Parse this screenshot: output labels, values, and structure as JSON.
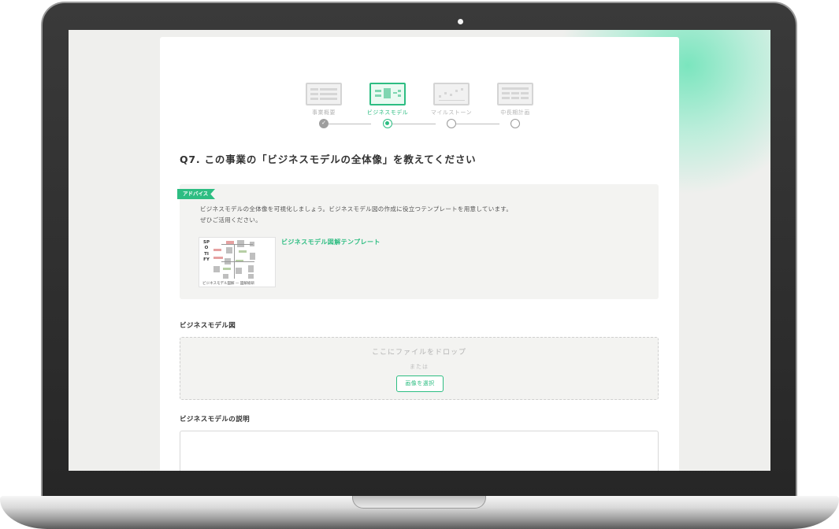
{
  "steps": [
    {
      "label": "事業概要",
      "state": "done",
      "check": "✓"
    },
    {
      "label": "ビジネスモデル",
      "state": "active"
    },
    {
      "label": "マイルストーン",
      "state": "todo"
    },
    {
      "label": "中長期計画",
      "state": "todo"
    }
  ],
  "question": {
    "title": "Q7. この事業の「ビジネスモデルの全体像」を教えてください"
  },
  "advice": {
    "badge": "アドバイス",
    "text": "ビジネスモデルの全体像を可視化しましょう。ビジネスモデル図の作成に役立つテンプレートを用意しています。\nぜひご活用ください。",
    "template_caption": "ビジネスモデル図解 — 図解総研",
    "template_thumb_text": "SPOTIFY",
    "template_link": "ビジネスモデル図解テンプレート"
  },
  "diagram_upload": {
    "label": "ビジネスモデル図",
    "drop_text": "ここにファイルをドロップ",
    "or_text": "または",
    "button_label": "画像を選択"
  },
  "description": {
    "label": "ビジネスモデルの説明",
    "value": ""
  },
  "colors": {
    "accent": "#2dbd82",
    "glow": "#6ee4b9"
  }
}
